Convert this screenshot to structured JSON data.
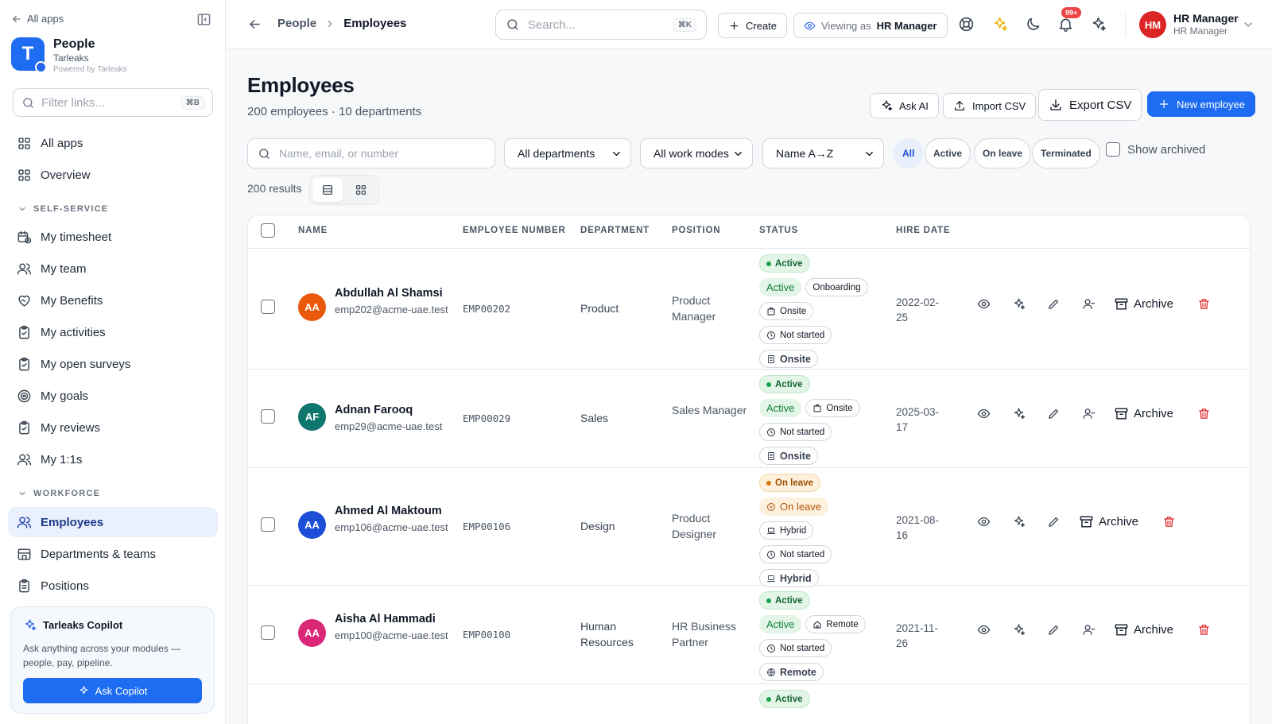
{
  "sidebar": {
    "all_apps": "All apps",
    "app_name": "People",
    "org": "Tarleaks",
    "powered": "Powered by Tarleaks",
    "logo_letter": "T",
    "filter_placeholder": "Filter links...",
    "filter_shortcut": "⌘B",
    "top_items": [
      "All apps",
      "Overview"
    ],
    "section_self": "SELF-SERVICE",
    "self_items": [
      "My timesheet",
      "My team",
      "My Benefits",
      "My activities",
      "My open surveys",
      "My goals",
      "My reviews",
      "My 1:1s"
    ],
    "section_workforce": "WORKFORCE",
    "workforce_items": [
      "Employees",
      "Departments & teams",
      "Positions"
    ],
    "copilot": {
      "title": "Tarleaks Copilot",
      "desc": "Ask anything across your modules — people, pay, pipeline.",
      "button": "Ask Copilot"
    }
  },
  "topbar": {
    "crumb_parent": "People",
    "crumb_current": "Employees",
    "search_placeholder": "Search...",
    "search_shortcut": "⌘K",
    "create": "Create",
    "viewing_prefix": "Viewing as",
    "viewing_role": "HR Manager",
    "notif_badge": "99+",
    "user_initials": "HM",
    "user_name": "HR Manager",
    "user_role": "HR Manager"
  },
  "page": {
    "title": "Employees",
    "subtitle": "200 employees · 10 departments",
    "ask_ai": "Ask AI",
    "import_csv": "Import CSV",
    "export_csv": "Export CSV",
    "new_employee": "New employee",
    "search_placeholder": "Name, email, or number",
    "dept_select": "All departments",
    "mode_select": "All work modes",
    "sort_select": "Name A→Z",
    "chips": [
      "All",
      "Active",
      "On leave",
      "Terminated"
    ],
    "show_archived": "Show archived",
    "results": "200 results"
  },
  "table": {
    "headers": [
      "NAME",
      "EMPLOYEE NUMBER",
      "DEPARTMENT",
      "POSITION",
      "STATUS",
      "HIRE DATE"
    ],
    "archive_label": "Archive",
    "rows": [
      {
        "initials": "AA",
        "color": "#ea580c",
        "name": "Abdullah Al Shamsi",
        "email": "emp202@acme-uae.test",
        "number": "EMP00202",
        "department": "Product",
        "position": "Product Manager",
        "status": "Active",
        "status_sub": "Active",
        "extra_tag": "Onboarding",
        "mode": "Onsite",
        "review": "Not started",
        "mode_bold": "Onsite",
        "hire": "2022-02-25"
      },
      {
        "initials": "AF",
        "color": "#0f766e",
        "name": "Adnan Farooq",
        "email": "emp29@acme-uae.test",
        "number": "EMP00029",
        "department": "Sales",
        "position": "Sales Manager",
        "status": "Active",
        "status_sub": "Active",
        "mode": "Onsite",
        "review": "Not started",
        "mode_bold": "Onsite",
        "hire": "2025-03-17"
      },
      {
        "initials": "AA",
        "color": "#1d4ed8",
        "name": "Ahmed Al Maktoum",
        "email": "emp106@acme-uae.test",
        "number": "EMP00106",
        "department": "Design",
        "position": "Product Designer",
        "status": "On leave",
        "status_sub": "On leave",
        "mode": "Hybrid",
        "review": "Not started",
        "mode_bold": "Hybrid",
        "hire": "2021-08-16"
      },
      {
        "initials": "AA",
        "color": "#db2777",
        "name": "Aisha Al Hammadi",
        "email": "emp100@acme-uae.test",
        "number": "EMP00100",
        "department": "Human Resources",
        "position": "HR Business Partner",
        "status": "Active",
        "status_sub": "Active",
        "mode": "Remote",
        "review": "Not started",
        "mode_bold": "Remote",
        "hire": "2021-11-26"
      },
      {
        "status": "Active"
      }
    ]
  }
}
